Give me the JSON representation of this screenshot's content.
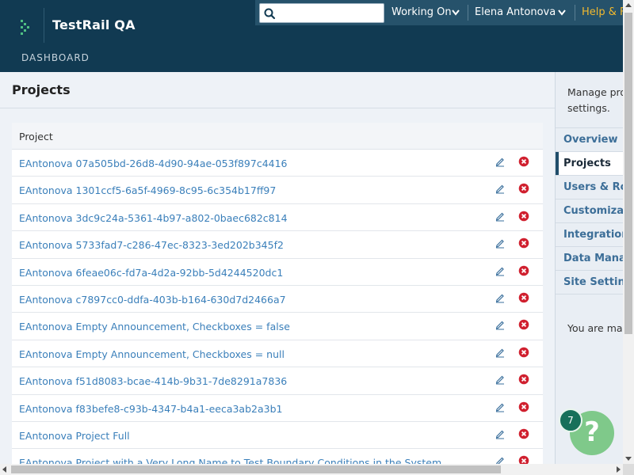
{
  "header": {
    "app_title": "TestRail QA",
    "nav": {
      "dashboard": "DASHBOARD"
    },
    "search": {
      "value": "",
      "placeholder": ""
    },
    "menu": {
      "working_on": "Working On",
      "user": "Elena Antonova",
      "help": "Help & Feedback"
    }
  },
  "page": {
    "title": "Projects"
  },
  "table": {
    "column_header": "Project",
    "rows": [
      "EAntonova 07a505bd-26d8-4d90-94ae-053f897c4416",
      "EAntonova 1301ccf5-6a5f-4969-8c95-6c354b17ff97",
      "EAntonova 3dc9c24a-5361-4b97-a802-0baec682c814",
      "EAntonova 5733fad7-c286-47ec-8323-3ed202b345f2",
      "EAntonova 6feae06c-fd7a-4d2a-92bb-5d4244520dc1",
      "EAntonova c7897cc0-ddfa-403b-b164-630d7d2466a7",
      "EAntonova Empty Announcement, Checkboxes = false",
      "EAntonova Empty Announcement, Checkboxes = null",
      "EAntonova f51d8083-bcae-414b-9b31-7de8291a7836",
      "EAntonova f83befe8-c93b-4347-b4a1-eeca3ab2a3b1",
      "EAntonova Project Full",
      "EAntonova Project with a Very Long Name to Test Boundary Conditions in the System"
    ]
  },
  "sidebar": {
    "description": "Manage projects and settings.",
    "description_line1": "Manage proj",
    "description_line2": "settings.",
    "items": [
      {
        "label": "Overview",
        "active": false
      },
      {
        "label": "Projects",
        "active": true
      },
      {
        "label": "Users & Roles",
        "active": false
      },
      {
        "label": "Customizations",
        "active": false
      },
      {
        "label": "Integration",
        "active": false
      },
      {
        "label": "Data Management",
        "active": false
      },
      {
        "label": "Site Settings",
        "active": false
      }
    ],
    "note": "You are managing"
  },
  "help_widget": {
    "symbol": "?",
    "badge_count": "7"
  },
  "colors": {
    "header_bg": "#113a52",
    "link": "#3a7fba",
    "delete": "#d0202f",
    "help": "#f2b92e",
    "help_fab": "#7fc98a"
  },
  "icons": {
    "logo": "testrail-logo-icon",
    "search": "search-icon",
    "dropdown": "chevron-down-icon",
    "edit": "pencil-icon",
    "delete": "delete-icon"
  }
}
